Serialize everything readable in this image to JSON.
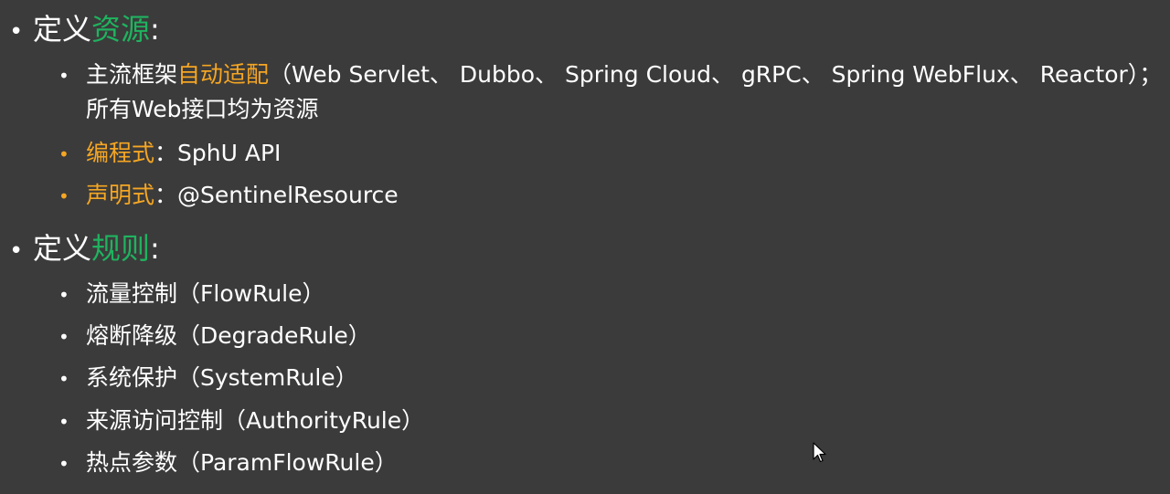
{
  "section1": {
    "prefix": "定义",
    "highlight": "资源",
    "suffix": ":",
    "items": [
      {
        "part1": "主流框架",
        "part2": "自动适配",
        "part3": "（Web Servlet、 Dubbo、 Spring Cloud、 gRPC、 Spring WebFlux、 Reactor）；",
        "line2": "所有Web接口均为资源"
      },
      {
        "label": "编程式",
        "text": "：SphU API"
      },
      {
        "label": "声明式",
        "text": "：@SentinelResource"
      }
    ]
  },
  "section2": {
    "prefix": "定义",
    "highlight": "规则",
    "suffix": ":",
    "items": [
      "流量控制（FlowRule）",
      "熔断降级（DegradeRule）",
      "系统保护（SystemRule）",
      "来源访问控制（AuthorityRule）",
      "热点参数（ParamFlowRule）"
    ]
  },
  "colors": {
    "background": "#3b3b3b",
    "text": "#ffffff",
    "green_accent": "#1fb35f",
    "orange_accent": "#f5a623"
  },
  "icons": {
    "bullet": "bullet-dot-icon",
    "cursor": "mouse-pointer-icon"
  }
}
